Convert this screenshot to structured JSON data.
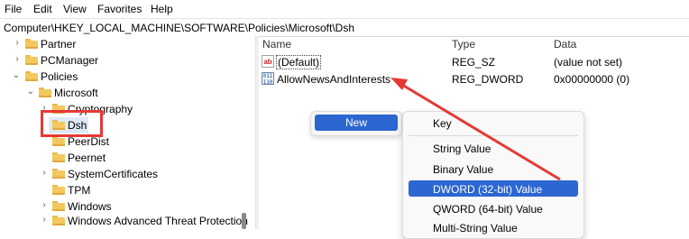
{
  "menubar": {
    "items": [
      "File",
      "Edit",
      "View",
      "Favorites",
      "Help"
    ]
  },
  "address": {
    "path": "Computer\\HKEY_LOCAL_MACHINE\\SOFTWARE\\Policies\\Microsoft\\Dsh"
  },
  "tree": {
    "items": [
      {
        "label": "Partner"
      },
      {
        "label": "PCManager"
      },
      {
        "label": "Policies"
      },
      {
        "label": "Microsoft"
      },
      {
        "label": "Cryptography"
      },
      {
        "label": "Dsh"
      },
      {
        "label": "PeerDist"
      },
      {
        "label": "Peernet"
      },
      {
        "label": "SystemCertificates"
      },
      {
        "label": "TPM"
      },
      {
        "label": "Windows"
      },
      {
        "label": "Windows Advanced Threat Protection"
      }
    ]
  },
  "list": {
    "columns": [
      "Name",
      "Type",
      "Data"
    ],
    "rows": [
      {
        "name": "(Default)",
        "type": "REG_SZ",
        "data": "(value not set)"
      },
      {
        "name": "AllowNewsAndInterests",
        "type": "REG_DWORD",
        "data": "0x00000000 (0)"
      }
    ]
  },
  "context_menu": {
    "new_label": "New",
    "submenu": [
      "Key",
      "String Value",
      "Binary Value",
      "DWORD (32-bit) Value",
      "QWORD (64-bit) Value",
      "Multi-String Value"
    ],
    "highlighted": "DWORD (32-bit) Value"
  },
  "colors": {
    "highlight": "#2b66d1",
    "annotation_red": "#e53935"
  },
  "icons": {
    "folder": "folder-icon",
    "string_value": "ab-string-icon",
    "binary_value": "binary-value-icon"
  }
}
